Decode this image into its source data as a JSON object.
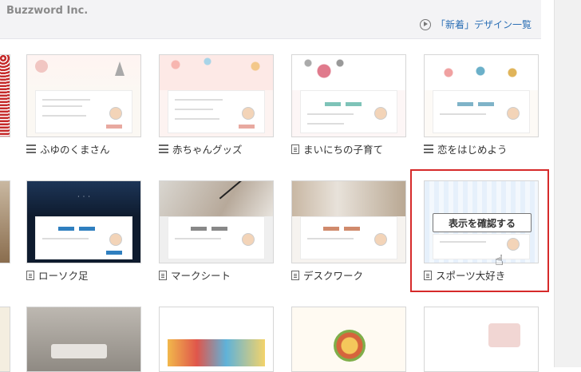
{
  "header": {
    "brand": "Buzzword Inc.",
    "new_designs_link": "「新着」デザイン一覧"
  },
  "row1": [
    {
      "label": "ふゆのくまさん",
      "icon": "list-icon"
    },
    {
      "label": "赤ちゃんグッズ",
      "icon": "list-icon"
    },
    {
      "label": "まいにちの子育て",
      "icon": "document-icon"
    },
    {
      "label": "恋をはじめよう",
      "icon": "list-icon"
    }
  ],
  "row2": [
    {
      "label": "ローソク足",
      "icon": "document-icon"
    },
    {
      "label": "マークシート",
      "icon": "document-icon"
    },
    {
      "label": "デスクワーク",
      "icon": "document-icon"
    },
    {
      "label": "スポーツ大好き",
      "icon": "document-icon"
    }
  ],
  "hover_overlay": {
    "label": "表示を確認する"
  },
  "colors": {
    "highlight": "#d62a2a",
    "link": "#2b6fb5"
  }
}
